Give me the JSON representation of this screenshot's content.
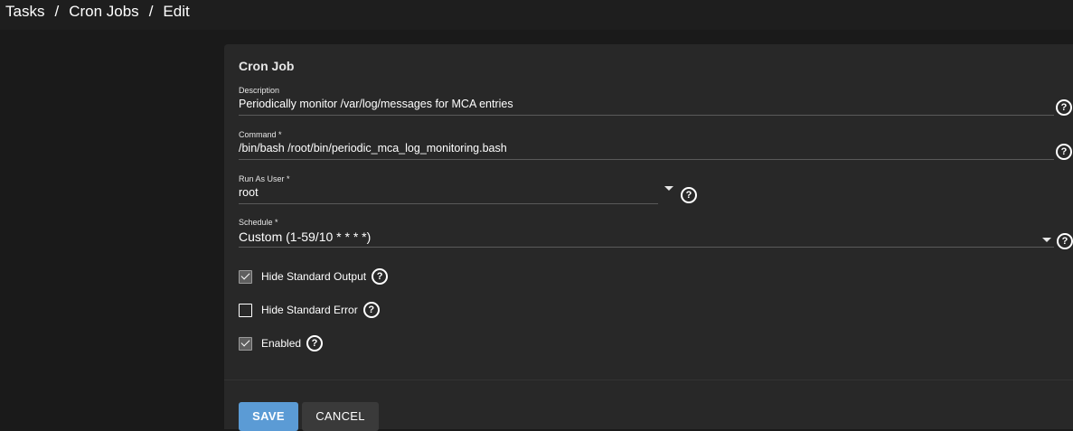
{
  "breadcrumb": {
    "items": [
      "Tasks",
      "Cron Jobs",
      "Edit"
    ],
    "separator": "/"
  },
  "form": {
    "title": "Cron Job",
    "description": {
      "label": "Description",
      "value": "Periodically monitor /var/log/messages for MCA entries"
    },
    "command": {
      "label": "Command *",
      "value": "/bin/bash /root/bin/periodic_mca_log_monitoring.bash"
    },
    "run_as_user": {
      "label": "Run As User *",
      "value": "root"
    },
    "schedule": {
      "label": "Schedule *",
      "value": "Custom (1-59/10 * * * *)"
    },
    "hide_stdout": {
      "label": "Hide Standard Output",
      "checked": true
    },
    "hide_stderr": {
      "label": "Hide Standard Error",
      "checked": false
    },
    "enabled": {
      "label": "Enabled",
      "checked": true
    },
    "help_glyph": "?"
  },
  "actions": {
    "save_label": "SAVE",
    "cancel_label": "CANCEL"
  },
  "colors": {
    "primary": "#5b9bd5",
    "card_bg": "#282828",
    "page_bg": "#1a1a1a"
  }
}
